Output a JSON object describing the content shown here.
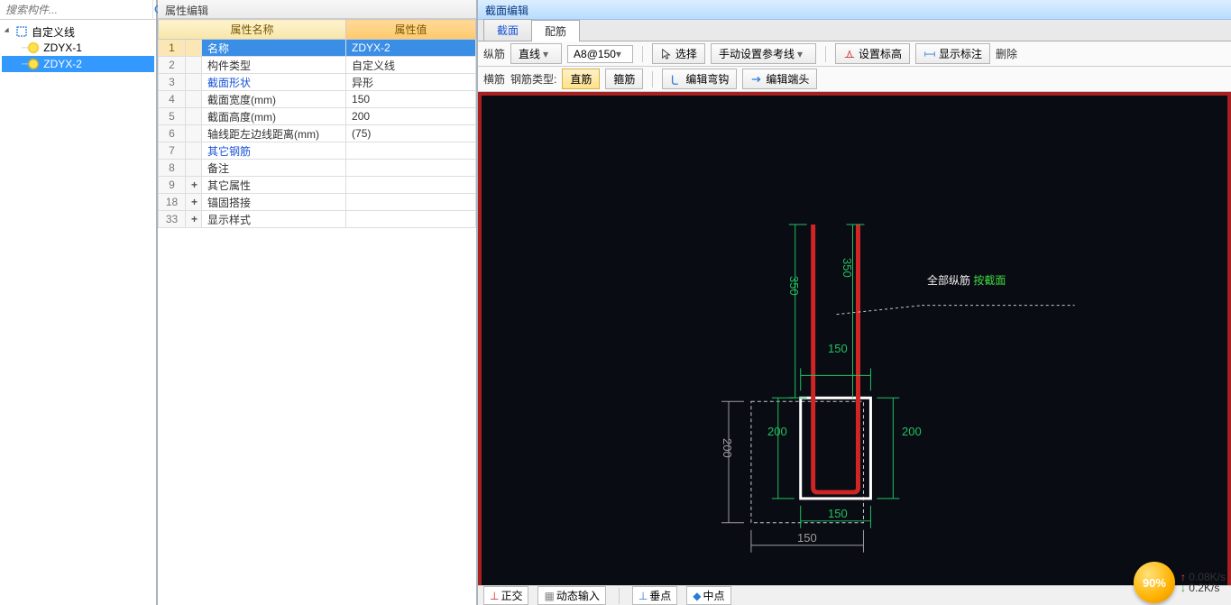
{
  "search": {
    "placeholder": "搜索构件..."
  },
  "tree": {
    "root": "自定义线",
    "items": [
      "ZDYX-1",
      "ZDYX-2"
    ],
    "selected_index": 1
  },
  "prop": {
    "panel_title": "属性编辑",
    "headers": {
      "name": "属性名称",
      "value": "属性值"
    },
    "rows": [
      {
        "n": "1",
        "exp": "",
        "name": "名称",
        "value": "ZDYX-2",
        "sel": true
      },
      {
        "n": "2",
        "exp": "",
        "name": "构件类型",
        "value": "自定义线"
      },
      {
        "n": "3",
        "exp": "",
        "name": "截面形状",
        "value": "异形",
        "blue": true
      },
      {
        "n": "4",
        "exp": "",
        "name": "截面宽度(mm)",
        "value": "150"
      },
      {
        "n": "5",
        "exp": "",
        "name": "截面高度(mm)",
        "value": "200"
      },
      {
        "n": "6",
        "exp": "",
        "name": "轴线距左边线距离(mm)",
        "value": "(75)"
      },
      {
        "n": "7",
        "exp": "",
        "name": "其它钢筋",
        "value": "",
        "blue": true
      },
      {
        "n": "8",
        "exp": "",
        "name": "备注",
        "value": ""
      },
      {
        "n": "9",
        "exp": "+",
        "name": "其它属性",
        "value": ""
      },
      {
        "n": "18",
        "exp": "+",
        "name": "锚固搭接",
        "value": ""
      },
      {
        "n": "33",
        "exp": "+",
        "name": "显示样式",
        "value": ""
      }
    ]
  },
  "editor": {
    "title": "截面编辑",
    "tabs": [
      "截面",
      "配筋"
    ],
    "active_tab": 1,
    "toolbar1": {
      "l_label": "纵筋",
      "mode_btn": "直线",
      "rebar_spec": "A8@150",
      "select": "选择",
      "manual_ref": "手动设置参考线",
      "set_elev": "设置标高",
      "show_dim": "显示标注",
      "delete": "删除"
    },
    "toolbar2": {
      "l_label": "横筋",
      "type_label": "钢筋类型:",
      "type_a": "直筋",
      "type_b": "箍筋",
      "edit_hook": "编辑弯钩",
      "edit_end": "编辑端头"
    },
    "annotation": {
      "white": "全部纵筋 ",
      "green": "按截面"
    },
    "dims": {
      "top_w": "150",
      "right_h": "200",
      "bot_w": "150",
      "left_gray_h": "200",
      "left_green_h": "200",
      "bot_gray_w": "150",
      "vbar_h_left": "350",
      "vbar_h_right": "350"
    }
  },
  "status": {
    "ortho": "正交",
    "dyn_input": "动态输入",
    "perp": "垂点",
    "mid": "中点"
  },
  "net": {
    "badge": "90%",
    "up": "0.08K/s",
    "down": "0.2K/s"
  }
}
